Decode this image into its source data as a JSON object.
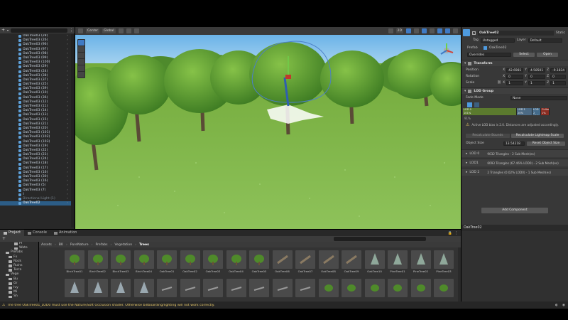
{
  "hierarchy": {
    "items": [
      {
        "label": "OakTree03 (28)",
        "state": "normal"
      },
      {
        "label": "OakTree03 (26)",
        "state": "normal"
      },
      {
        "label": "OakTree03 (96)",
        "state": "normal"
      },
      {
        "label": "OakTree03 (97)",
        "state": "normal"
      },
      {
        "label": "OakTree03 (98)",
        "state": "normal"
      },
      {
        "label": "OakTree03 (99)",
        "state": "normal"
      },
      {
        "label": "OakTree03 (100)",
        "state": "normal"
      },
      {
        "label": "OakTree03 (29)",
        "state": "normal"
      },
      {
        "label": "OakTree03 (24)",
        "state": "normal"
      },
      {
        "label": "OakTree03 (38)",
        "state": "normal"
      },
      {
        "label": "OakTree03 (37)",
        "state": "normal"
      },
      {
        "label": "OakTree03 (25)",
        "state": "normal"
      },
      {
        "label": "OakTree03 (39)",
        "state": "normal"
      },
      {
        "label": "OakTree03 (10)",
        "state": "normal"
      },
      {
        "label": "OakTree03 (36)",
        "state": "normal"
      },
      {
        "label": "OakTree03 (12)",
        "state": "normal"
      },
      {
        "label": "OakTree03 (11)",
        "state": "normal"
      },
      {
        "label": "OakTree03 (14)",
        "state": "normal"
      },
      {
        "label": "OakTree03 (13)",
        "state": "normal"
      },
      {
        "label": "OakTree03 (15)",
        "state": "normal"
      },
      {
        "label": "OakTree03 (21)",
        "state": "normal"
      },
      {
        "label": "OakTree03 (20)",
        "state": "normal"
      },
      {
        "label": "OakTree03 (101)",
        "state": "normal"
      },
      {
        "label": "OakTree03 (102)",
        "state": "normal"
      },
      {
        "label": "OakTree03 (103)",
        "state": "normal"
      },
      {
        "label": "OakTree03 (19)",
        "state": "normal"
      },
      {
        "label": "OakTree03 (22)",
        "state": "normal"
      },
      {
        "label": "OakTree03 (23)",
        "state": "normal"
      },
      {
        "label": "OakTree03 (24)",
        "state": "normal"
      },
      {
        "label": "OakTree03 (18)",
        "state": "normal"
      },
      {
        "label": "OakTree03 (17)",
        "state": "normal"
      },
      {
        "label": "OakTree03 (16)",
        "state": "normal"
      },
      {
        "label": "OakTree03 (30)",
        "state": "normal"
      },
      {
        "label": "OakTree03 (16)",
        "state": "normal"
      },
      {
        "label": "OakTree03 (5)",
        "state": "normal"
      },
      {
        "label": "OakTree03 (7)",
        "state": "normal"
      },
      {
        "label": "Ⅱ",
        "state": "dim"
      },
      {
        "label": "Directional Light (1)",
        "state": "dim"
      },
      {
        "label": "OakTree02",
        "state": "sel"
      }
    ]
  },
  "scene_toolbar": {
    "pivot": "Center",
    "space": "Global",
    "right_btn": "2D"
  },
  "inspector": {
    "object_name": "OakTree02",
    "static_label": "Static",
    "tag_label": "Tag",
    "tag_value": "Untagged",
    "layer_label": "Layer",
    "layer_value": "Default",
    "prefab_label": "Prefab",
    "prefab_value": "OakTree02",
    "overrides": "Overrides",
    "select": "Select",
    "open": "Open",
    "transform_title": "Transform",
    "position_label": "Position",
    "rotation_label": "Rotation",
    "scale_label": "Scale",
    "pos": {
      "x": "42.6981",
      "y": "4.58501",
      "z": "-9.1834"
    },
    "rot": {
      "x": "0",
      "y": "0",
      "z": "0"
    },
    "scl": {
      "x": "1",
      "y": "1",
      "z": "1"
    },
    "lod_title": "LOD Group",
    "fade_mode_label": "Fade Mode",
    "fade_mode_value": "None",
    "lod_bar": [
      {
        "label": "LOD 0",
        "pct": "101%",
        "color": "#5b7a2e"
      },
      {
        "label": "LOD 1",
        "pct": "20%",
        "color": "#4c6a84"
      },
      {
        "label": "LOD 2",
        "pct": "10%",
        "color": "#446b8a"
      },
      {
        "label": "Culled",
        "pct": "1%",
        "color": "#8a2d22"
      }
    ],
    "lod_bar_pct_under": "91%",
    "lod_info": "Active LOD bias is 2.0. Distances are adjusted accordingly.",
    "recalc_bounds": "Recalculate Bounds",
    "recalc_lightmap": "Recalculate Lightmap Scale",
    "object_size_label": "Object Size",
    "object_size_value": "13.54218",
    "reset_object_size": "Reset Object Size",
    "lods": [
      {
        "name": "LOD 0",
        "info": "9032 Triangles  - 2 Sub Mesh(es)"
      },
      {
        "name": "LOD1",
        "info": "6093 Triangles (67.46% LOD0) - 2 Sub Mesh(es)"
      },
      {
        "name": "LOD 2",
        "info": "2 Triangles (0.02% LOD0) - 1 Sub Mesh(es)"
      }
    ],
    "add_component": "Add Component",
    "preview_title": "OakTree02"
  },
  "bottom": {
    "tabs": [
      "Project",
      "Console",
      "Animation"
    ],
    "folders": [
      "Pl",
      "Wate",
      "Prefabs",
      "Fx",
      "Rock",
      "Ruins",
      "Terra",
      "Vege",
      "Bu",
      "Gr",
      "Ivy",
      "Mi",
      "Sh"
    ],
    "breadcrumb": [
      "Assets",
      "BK",
      "PureNature",
      "Prefabs",
      "Vegetation",
      "Trees"
    ],
    "assets_row1": [
      "BirchTree01",
      "BirchTree02",
      "BirchTree03",
      "BirchTree04",
      "OakTree01",
      "OakTree02",
      "OakTree03",
      "OakTree04",
      "OakTree05",
      "OakTree06",
      "OakTree07",
      "OakTree08",
      "OakTree09",
      "OakTree10",
      "PineTree01",
      "PineTree02",
      "PineTree03"
    ],
    "slider_value": "0.42"
  },
  "status": {
    "message": "The tree OakTree01_LOD0 must use the Nature/Soft Occlusion shader. Otherwise billboarding/lighting will not work correctly."
  },
  "colors": {
    "accent": "#2c5d87",
    "warning": "#e8c96a",
    "grass": "#7fb24a"
  }
}
